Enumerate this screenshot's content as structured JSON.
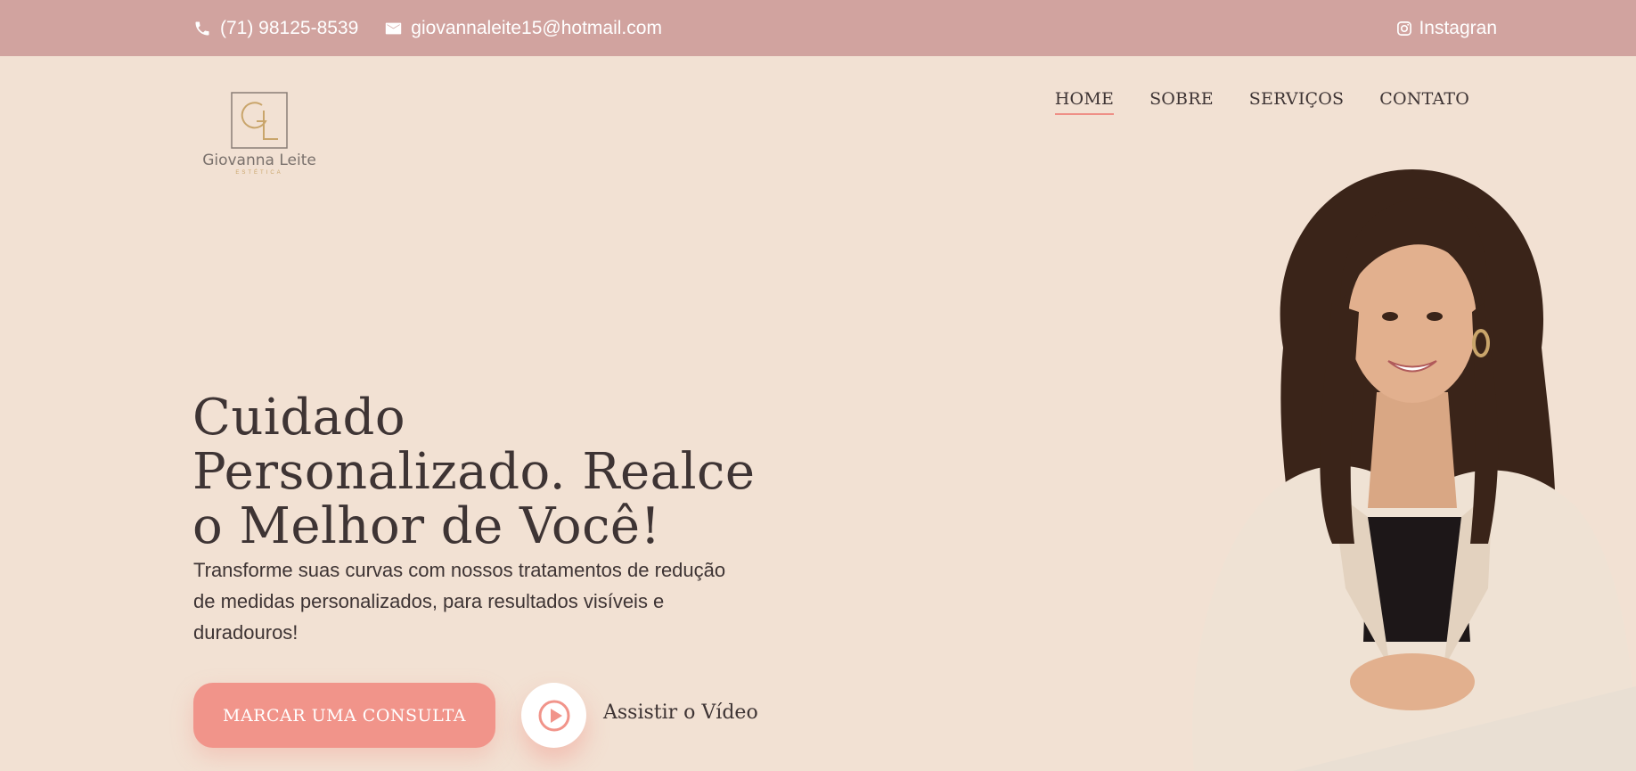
{
  "topbar": {
    "phone": "(71) 98125-8539",
    "email": "giovannaleite15@hotmail.com",
    "social": "Instagran",
    "icons": {
      "phone": "phone-icon",
      "email": "mail-icon",
      "social": "instagram-icon"
    }
  },
  "brand": {
    "name": "Giovanna Leite",
    "tagline": "ESTÉTICA",
    "monogram": "GL"
  },
  "nav": {
    "items": [
      {
        "label": "HOME",
        "active": true
      },
      {
        "label": "SOBRE",
        "active": false
      },
      {
        "label": "SERVIÇOS",
        "active": false
      },
      {
        "label": "CONTATO",
        "active": false
      }
    ]
  },
  "hero": {
    "title": "Cuidado Personalizado. Realce o Melhor de Você!",
    "description": "Transforme suas curvas com nossos tratamentos de redução de medidas personalizados, para resultados visíveis e duradouros!",
    "cta_label": "MARCAR UMA CONSULTA",
    "video_label": "Assistir o Vídeo"
  },
  "colors": {
    "background": "#f2e1d3",
    "topbar": "#d1a39f",
    "accent": "#f1948a",
    "text": "#3e3434",
    "gold": "#c9a56b"
  }
}
